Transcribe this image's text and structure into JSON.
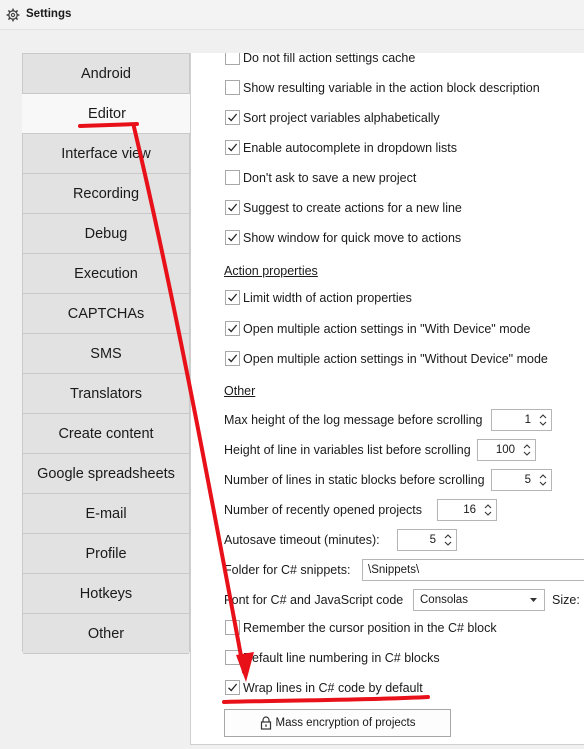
{
  "window": {
    "title": "Settings"
  },
  "sidebar": {
    "tabs": [
      {
        "label": "Android"
      },
      {
        "label": "Editor"
      },
      {
        "label": "Interface view"
      },
      {
        "label": "Recording"
      },
      {
        "label": "Debug"
      },
      {
        "label": "Execution"
      },
      {
        "label": "CAPTCHAs"
      },
      {
        "label": "SMS"
      },
      {
        "label": "Translators"
      },
      {
        "label": "Create content"
      },
      {
        "label": "Google spreadsheets"
      },
      {
        "label": "E-mail"
      },
      {
        "label": "Profile"
      },
      {
        "label": "Hotkeys"
      },
      {
        "label": "Other"
      }
    ],
    "active": "Editor"
  },
  "editor": {
    "options": [
      {
        "label": "Do not fill action settings cache",
        "checked": false
      },
      {
        "label": "Show resulting variable in the action block description",
        "checked": false
      },
      {
        "label": "Sort project variables alphabetically",
        "checked": true
      },
      {
        "label": "Enable autocomplete in dropdown lists",
        "checked": true
      },
      {
        "label": "Don't ask to save a new project",
        "checked": false
      },
      {
        "label": "Suggest to create actions for a new line",
        "checked": true
      },
      {
        "label": "Show window for quick move to actions",
        "checked": true
      }
    ],
    "action_properties": {
      "heading": "Action properties",
      "options": [
        {
          "label": "Limit width of action properties",
          "checked": true
        },
        {
          "label": "Open multiple action settings in \"With Device\" mode",
          "checked": true
        },
        {
          "label": "Open multiple action settings in \"Without Device\" mode",
          "checked": true
        }
      ]
    },
    "other": {
      "heading": "Other",
      "max_log_height": {
        "label": "Max height of the log message before scrolling",
        "value": "1"
      },
      "var_line_height": {
        "label": "Height of line in variables list before scrolling",
        "value": "100"
      },
      "static_lines": {
        "label": "Number of lines in static blocks before scrolling",
        "value": "5"
      },
      "recent_projects": {
        "label": "Number of recently opened projects",
        "value": "16"
      },
      "autosave": {
        "label": "Autosave timeout (minutes):",
        "value": "5"
      },
      "snippets_folder": {
        "label": "Folder for C# snippets:",
        "value": "\\Snippets\\"
      },
      "font": {
        "label": "Font for C# and JavaScript code",
        "value": "Consolas",
        "size_label": "Size:"
      },
      "remember_cursor": {
        "label": "Remember the cursor position in the C# block",
        "checked": false
      },
      "line_numbering": {
        "label": "Default line numbering in C# blocks",
        "checked": false
      },
      "wrap_lines": {
        "label": "Wrap lines in C# code by default",
        "checked": true
      },
      "mass_encryption_button": "Mass encryption of projects"
    }
  },
  "annotation": {
    "color": "#e8111a"
  }
}
